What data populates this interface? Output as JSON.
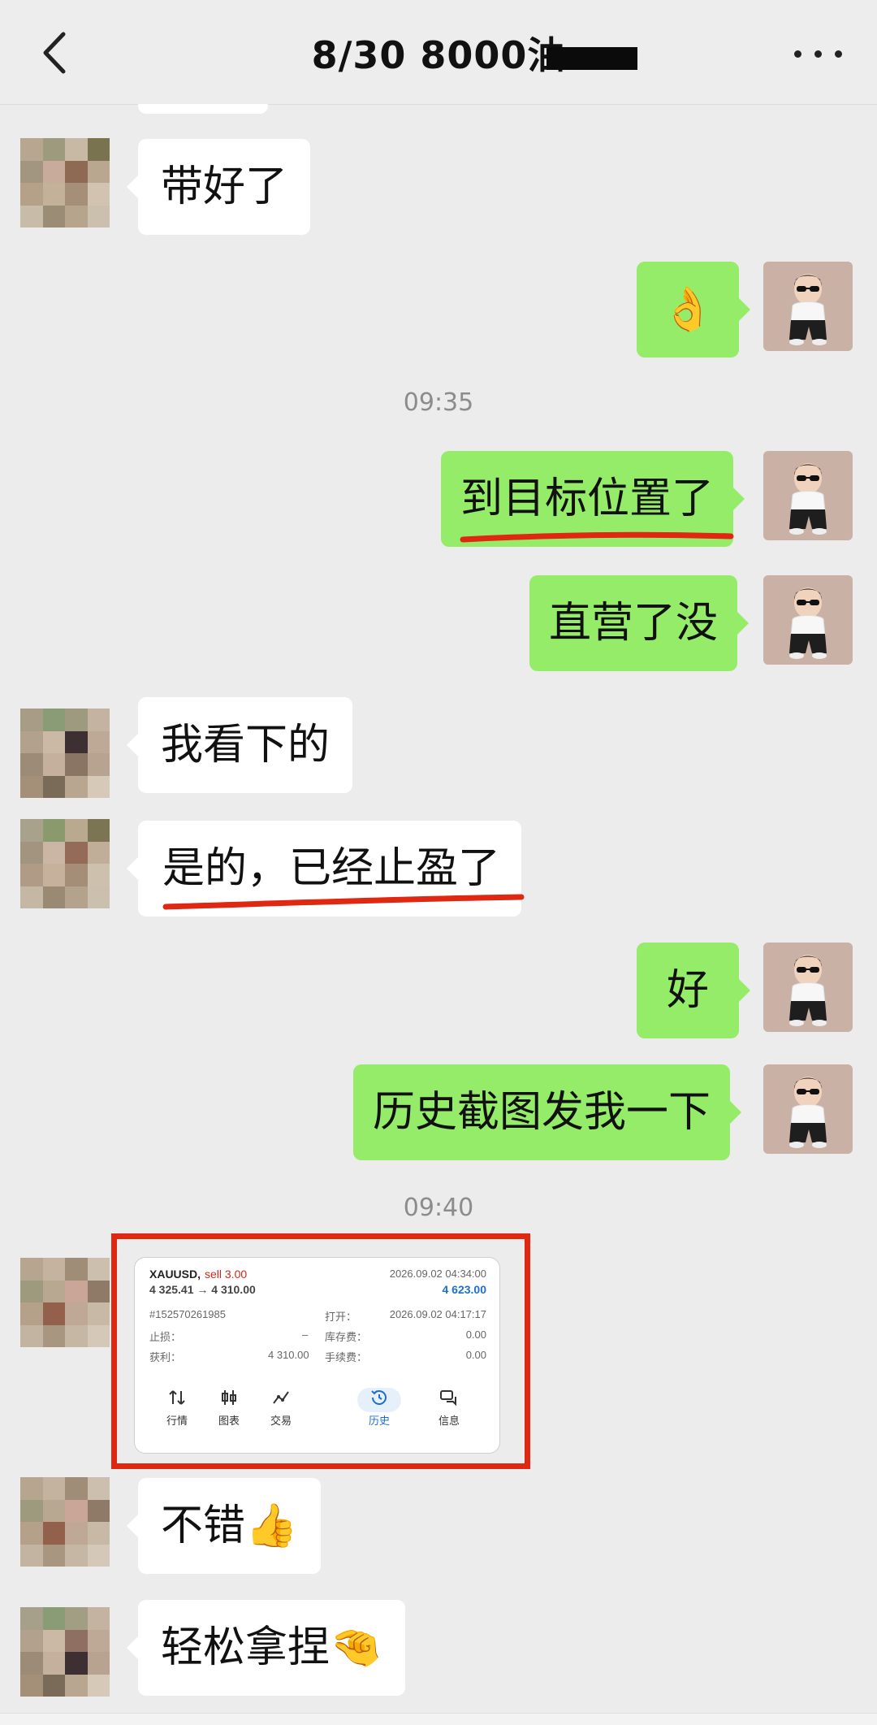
{
  "header": {
    "title": "8/30  8000油"
  },
  "timestamps": [
    "09:35",
    "09:40"
  ],
  "messages": {
    "m1": "带好了",
    "m2": "👌",
    "m3": "到目标位置了",
    "m4": "直营了没",
    "m5": "我看下的",
    "m6": "是的，已经止盈了",
    "m7": "好",
    "m8": "历史截图发我一下",
    "m9": "不错👍",
    "m10": "轻松拿捏🤏"
  },
  "trade_card": {
    "symbol": "XAUUSD,",
    "side": "sell 3.00",
    "prices": "4 325.41 → 4 310.00",
    "close_time": "2026.09.02 04:34:00",
    "profit": "4 623.00",
    "order_id": "#152570261985",
    "open_label": "打开：",
    "open_time": "2026.09.02 04:17:17",
    "sl_label": "止损：",
    "sl_value": "–",
    "swap_label": "库存费：",
    "swap_value": "0.00",
    "tp_label": "获利：",
    "tp_value": "4 310.00",
    "fee_label": "手续费：",
    "fee_value": "0.00",
    "nav": [
      "行情",
      "图表",
      "交易",
      "历史",
      "信息"
    ]
  },
  "colors": {
    "incoming_bubble": "#ffffff",
    "outgoing_bubble": "#95ec69",
    "annotation_red": "#e02712",
    "active_tab": "#1e6fc9",
    "background": "#ececec"
  }
}
